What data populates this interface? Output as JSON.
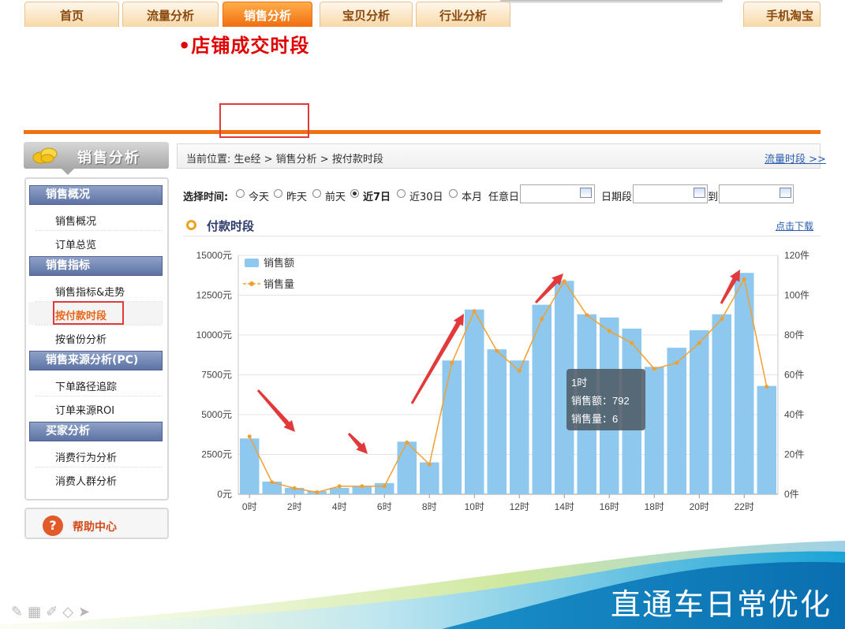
{
  "slide_title": "•店铺成交时段",
  "tabs": [
    {
      "label": "首页"
    },
    {
      "label": "流量分析"
    },
    {
      "label": "销售分析"
    },
    {
      "label": "宝贝分析"
    },
    {
      "label": "行业分析"
    },
    {
      "label": "手机淘宝"
    }
  ],
  "sidebar": {
    "title": "销售分析",
    "groups": [
      {
        "label": "销售概况",
        "items": [
          "销售概况",
          "订单总览"
        ]
      },
      {
        "label": "销售指标",
        "items": [
          "销售指标&走势",
          "按付款时段",
          "按省份分析"
        ]
      },
      {
        "label": "销售来源分析(PC)",
        "items": [
          "下单路径追踪",
          "订单来源ROI"
        ]
      },
      {
        "label": "买家分析",
        "items": [
          "消费行为分析",
          "消费人群分析"
        ]
      }
    ],
    "help_label": "帮助中心"
  },
  "breadcrumb": {
    "text": "当前位置: 生e经 > 销售分析 > 按付款时段",
    "right_link": "流量时段 >>"
  },
  "filter": {
    "label": "选择时间:",
    "options": [
      "今天",
      "昨天",
      "前天",
      "近7日",
      "近30日",
      "本月"
    ],
    "selected": "近7日",
    "any_day_label": "任意日",
    "date_range_label": "日期段",
    "to_label": "到",
    "any_day_value": "",
    "date_from_value": "",
    "date_to_value": ""
  },
  "section": {
    "title": "付款时段",
    "download_label": "点击下载"
  },
  "tooltip": {
    "title": "1时",
    "line1": "销售额：792",
    "line2": "销售量：6"
  },
  "colors": {
    "bar": "#8fc8ef",
    "line": "#f0a030",
    "tab_active": "#f1700f",
    "slide_title": "#e00000",
    "annotation_box": "#e23a3a"
  },
  "chart_data": {
    "type": "bar",
    "x": [
      0,
      1,
      2,
      3,
      4,
      5,
      6,
      7,
      8,
      9,
      10,
      11,
      12,
      13,
      14,
      15,
      16,
      17,
      18,
      19,
      20,
      21,
      22,
      23
    ],
    "x_tick_labels": [
      "0时",
      "2时",
      "4时",
      "6时",
      "8时",
      "10时",
      "12时",
      "14时",
      "16时",
      "18时",
      "20时",
      "22时"
    ],
    "series": [
      {
        "name": "销售额",
        "type": "bar",
        "axis": "left",
        "values": [
          3500,
          792,
          400,
          200,
          400,
          500,
          700,
          3300,
          2000,
          8400,
          11600,
          9100,
          8400,
          11900,
          13400,
          11300,
          11100,
          10400,
          8000,
          9200,
          10300,
          11300,
          13900,
          6800
        ]
      },
      {
        "name": "销售量",
        "type": "line",
        "axis": "right",
        "values": [
          29,
          6,
          3,
          1,
          4,
          4,
          4,
          26,
          15,
          66,
          92,
          72,
          62,
          88,
          107,
          90,
          82,
          76,
          63,
          66,
          76,
          88,
          108,
          54
        ]
      }
    ],
    "y_left": {
      "min": 0,
      "max": 15000,
      "ticks": [
        "0元",
        "2500元",
        "5000元",
        "7500元",
        "10000元",
        "12500元",
        "15000元"
      ]
    },
    "y_right": {
      "min": 0,
      "max": 120,
      "ticks": [
        "0件",
        "20件",
        "40件",
        "60件",
        "80件",
        "100件",
        "120件"
      ]
    },
    "grid": true,
    "legend_position": "top-left"
  }
}
